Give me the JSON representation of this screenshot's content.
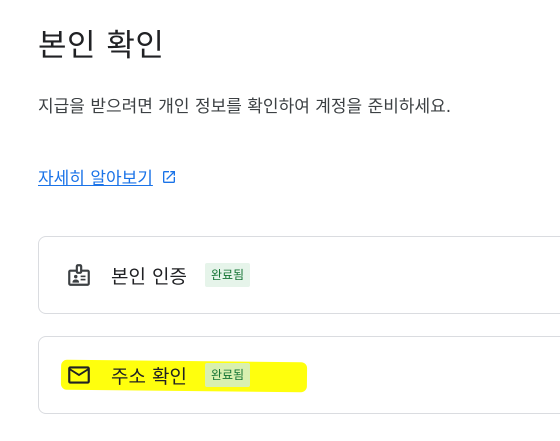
{
  "page": {
    "title": "본인 확인",
    "description": "지급을 받으려면 개인 정보를 확인하여 계정을 준비하세요.",
    "learn_more": "자세히 알아보기"
  },
  "cards": [
    {
      "label": "본인 인증",
      "status": "완료됨",
      "icon": "id-card-icon"
    },
    {
      "label": "주소 확인",
      "status": "완료됨",
      "icon": "mail-icon"
    }
  ],
  "colors": {
    "link": "#1a73e8",
    "badge_bg": "#e6f4ea",
    "badge_text": "#137333",
    "highlight": "#ffff00"
  }
}
